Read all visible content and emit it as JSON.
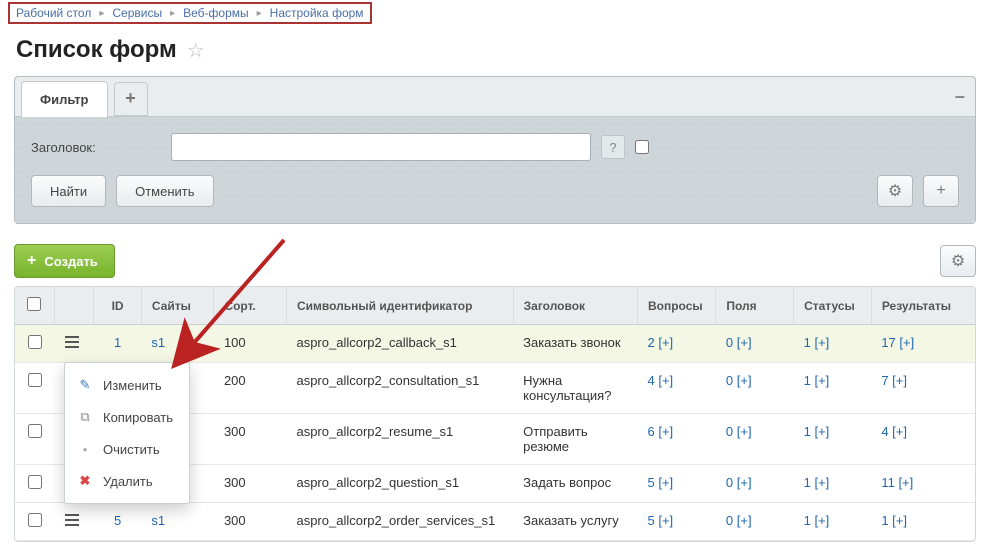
{
  "breadcrumb": [
    "Рабочий стол",
    "Сервисы",
    "Веб-формы",
    "Настройка форм"
  ],
  "page_title": "Список форм",
  "filter": {
    "tab_label": "Фильтр",
    "field_label": "Заголовок:",
    "input_value": "",
    "find_label": "Найти",
    "cancel_label": "Отменить"
  },
  "toolbar": {
    "create_label": "Создать"
  },
  "columns": {
    "id": "ID",
    "sites": "Сайты",
    "sort": "Сорт.",
    "symbol": "Символьный идентификатор",
    "title": "Заголовок",
    "questions": "Вопросы",
    "fields": "Поля",
    "statuses": "Статусы",
    "results": "Результаты"
  },
  "rows": [
    {
      "id": "1",
      "site": "s1",
      "sort": "100",
      "symbol": "aspro_allcorp2_callback_s1",
      "title": "Заказать звонок",
      "questions": "2",
      "fields": "0",
      "statuses": "1",
      "results": "17",
      "highlight": true
    },
    {
      "id": "",
      "site": "",
      "sort": "200",
      "symbol": "aspro_allcorp2_consultation_s1",
      "title": "Нужна консультация?",
      "questions": "4",
      "fields": "0",
      "statuses": "1",
      "results": "7"
    },
    {
      "id": "",
      "site": "",
      "sort": "300",
      "symbol": "aspro_allcorp2_resume_s1",
      "title": "Отправить резюме",
      "questions": "6",
      "fields": "0",
      "statuses": "1",
      "results": "4"
    },
    {
      "id": "",
      "site": "",
      "sort": "300",
      "symbol": "aspro_allcorp2_question_s1",
      "title": "Задать вопрос",
      "questions": "5",
      "fields": "0",
      "statuses": "1",
      "results": "11"
    },
    {
      "id": "5",
      "site": "s1",
      "sort": "300",
      "symbol": "aspro_allcorp2_order_services_s1",
      "title": "Заказать услугу",
      "questions": "5",
      "fields": "0",
      "statuses": "1",
      "results": "1"
    }
  ],
  "ctx": {
    "edit": "Изменить",
    "copy": "Копировать",
    "clear": "Очистить",
    "delete": "Удалить"
  },
  "plus": "[+]"
}
